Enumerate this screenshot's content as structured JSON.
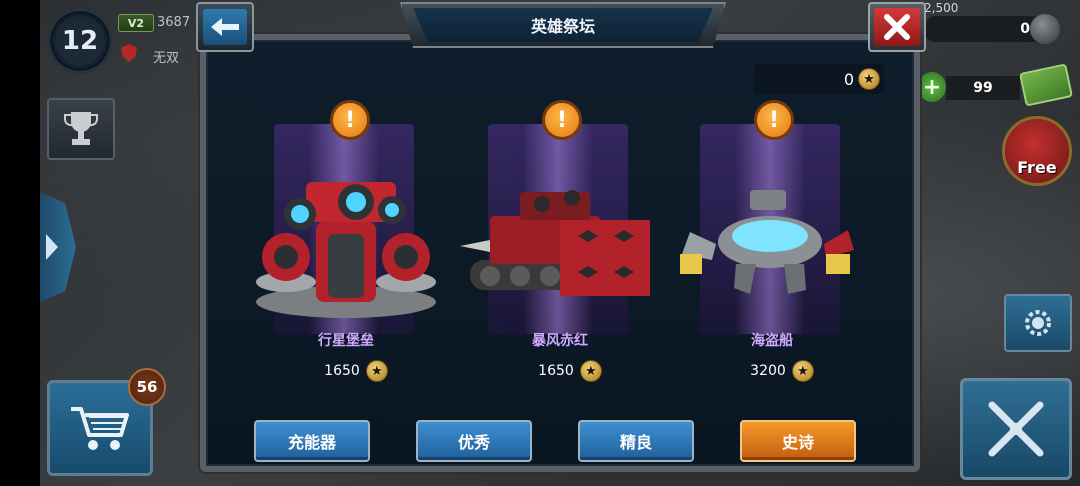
{
  "hud": {
    "level": "12",
    "vip_label": "V2",
    "power": "3687",
    "clan": "无双",
    "shop_count": "56",
    "resource_top": "2,500",
    "resource_value": "0",
    "cash_value": "99",
    "free_label": "Free"
  },
  "dialog": {
    "title": "英雄祭坛",
    "star_balance": "0",
    "heroes": [
      {
        "name": "行星堡垒",
        "price": "1650",
        "icon": "planet-fortress-tank-art"
      },
      {
        "name": "暴风赤红",
        "price": "1650",
        "icon": "storm-crimson-tank-art"
      },
      {
        "name": "海盗船",
        "price": "3200",
        "icon": "pirate-ship-hover-art"
      }
    ],
    "tiers": {
      "charger": "充能器",
      "excellent": "优秀",
      "elite": "精良",
      "epic": "史诗"
    }
  },
  "colors": {
    "accent_blue": "#2e7bb1",
    "epic_orange": "#f59a2a",
    "hero_name": "#cfa8ff",
    "close_red": "#d33a3a"
  }
}
